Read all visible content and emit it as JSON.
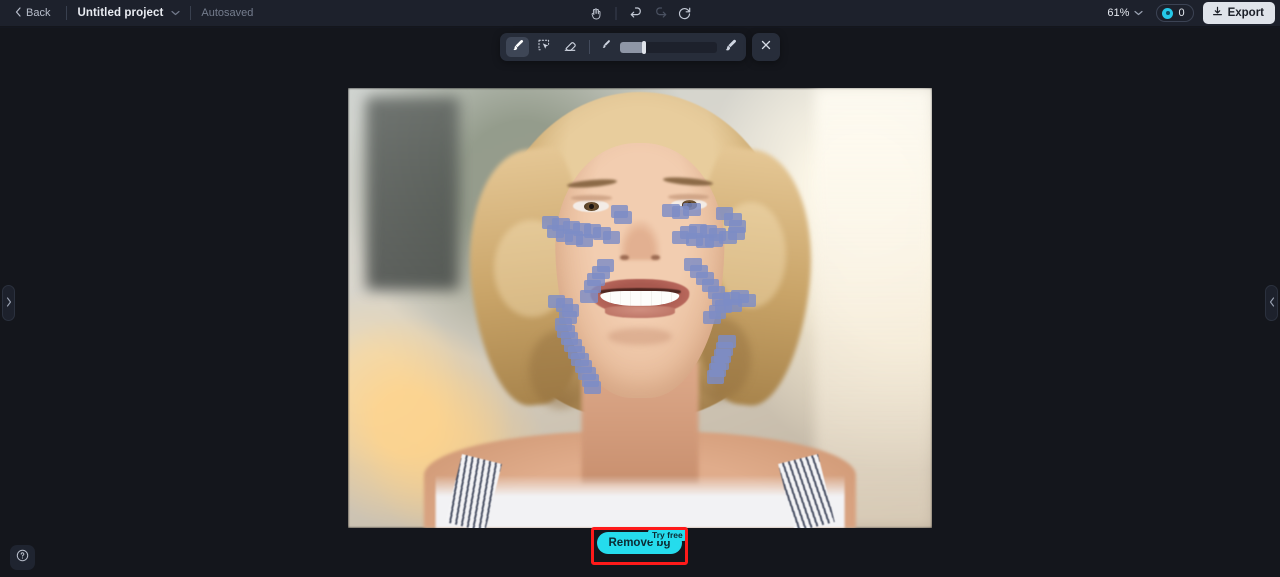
{
  "header": {
    "back_label": "Back",
    "project_title": "Untitled project",
    "autosave_status": "Autosaved",
    "zoom_level": "61%",
    "credits_count": "0",
    "export_label": "Export",
    "icons": {
      "back_chevron": "chevron-left-icon",
      "title_chevron": "chevron-down-icon",
      "pan": "hand-pan-icon",
      "undo": "undo-icon",
      "redo": "redo-icon",
      "reset": "reset-icon",
      "zoom_chevron": "chevron-down-icon",
      "coin": "credit-coin-icon",
      "export": "download-icon"
    }
  },
  "toolbar": {
    "tools": [
      {
        "name": "brush-tool",
        "icon": "brush-icon",
        "active": true
      },
      {
        "name": "magic-select-tool",
        "icon": "magic-cursor-icon",
        "active": false
      },
      {
        "name": "eraser-tool",
        "icon": "eraser-icon",
        "active": false
      }
    ],
    "brush_size": {
      "small_icon": "brush-small-icon",
      "large_icon": "brush-large-icon",
      "value_percent": 25
    },
    "close_label": "close-icon"
  },
  "canvas": {
    "left_handle_icon": "chevron-right-icon",
    "right_handle_icon": "chevron-left-icon",
    "help_icon": "question-circle-icon",
    "photo_alt": "portrait of smiling blonde woman with blue retouch brush strokes on face"
  },
  "bottom_action": {
    "remove_label": "Remove bg",
    "badge_label": "Try free",
    "accent_color": "#25dced",
    "highlight_color": "#ff1a1a"
  },
  "colors": {
    "header_bg": "#1d212c",
    "canvas_bg": "#14161c",
    "toolbar_bg": "#272d3a",
    "stroke_blue": "#7d8cc6",
    "export_bg": "#dfe3ea"
  }
}
